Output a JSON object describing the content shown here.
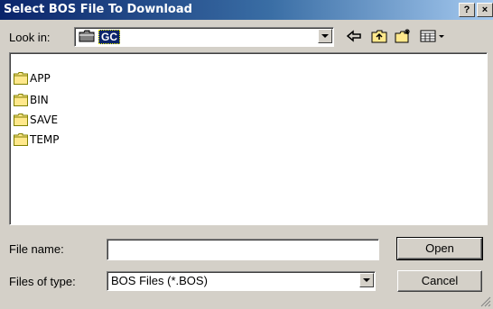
{
  "window": {
    "title": "Select BOS File To Download",
    "help_label": "?",
    "close_label": "×"
  },
  "toolbar": {
    "look_in_label": "Look in:",
    "look_in_value": "GC",
    "icons": [
      "folder-icon",
      "back-arrow-icon",
      "up-folder-icon",
      "new-folder-icon",
      "views-menu-icon"
    ]
  },
  "file_list": {
    "items": [
      {
        "name": "APP",
        "icon": "folder-icon"
      },
      {
        "name": "BIN",
        "icon": "folder-icon"
      },
      {
        "name": "SAVE",
        "icon": "folder-icon"
      },
      {
        "name": "TEMP",
        "icon": "folder-icon"
      }
    ]
  },
  "form": {
    "file_name_label": "File name:",
    "file_name_value": "",
    "files_of_type_label": "Files of type:",
    "files_of_type_value": "BOS Files (*.BOS)"
  },
  "buttons": {
    "open": "Open",
    "cancel": "Cancel"
  },
  "colors": {
    "titlebar_start": "#0a246a",
    "titlebar_end": "#a6caf0",
    "dialog_face": "#d4d0c8",
    "folder_yellow": "#ffe88c"
  }
}
